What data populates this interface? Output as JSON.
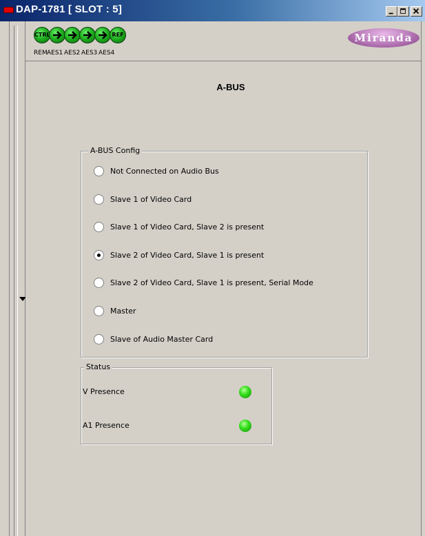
{
  "window": {
    "title": "DAP-1781 [ SLOT : 5]"
  },
  "header": {
    "icons": [
      {
        "name": "ctrl-icon",
        "text": "CTRL",
        "label": "REM"
      },
      {
        "name": "arrow-icon",
        "text": "",
        "label": "AES1"
      },
      {
        "name": "arrow-icon",
        "text": "",
        "label": "AES2"
      },
      {
        "name": "arrow-icon",
        "text": "",
        "label": "AES3"
      },
      {
        "name": "arrow-icon",
        "text": "",
        "label": "AES4"
      },
      {
        "name": "ref-icon",
        "text": "REF",
        "label": ""
      }
    ],
    "logo": "Miranda"
  },
  "page": {
    "title": "A-BUS"
  },
  "config": {
    "legend": "A-BUS Config",
    "options": [
      {
        "label": "Not Connected on Audio Bus",
        "checked": false
      },
      {
        "label": "Slave 1 of Video Card",
        "checked": false
      },
      {
        "label": "Slave 1 of Video Card, Slave 2 is present",
        "checked": false
      },
      {
        "label": "Slave 2 of Video Card, Slave 1 is present",
        "checked": true
      },
      {
        "label": "Slave 2 of Video Card, Slave 1 is present, Serial Mode",
        "checked": false
      },
      {
        "label": "Master",
        "checked": false
      },
      {
        "label": "Slave of Audio Master Card",
        "checked": false
      }
    ]
  },
  "status": {
    "legend": "Status",
    "items": [
      {
        "label": "V Presence",
        "state": "green"
      },
      {
        "label": "A1 Presence",
        "state": "green"
      }
    ]
  },
  "colors": {
    "titlebar": "#0a246a",
    "led_on": "#38e020",
    "face": "#d4d0c8"
  }
}
